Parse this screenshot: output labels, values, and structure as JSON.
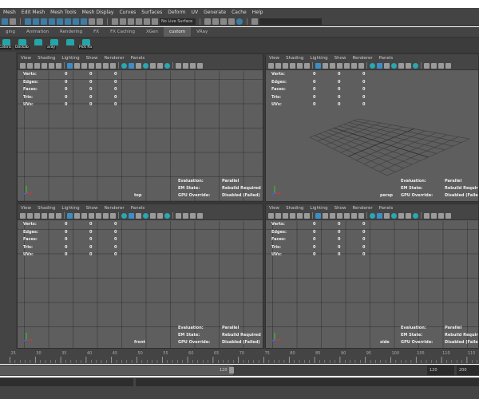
{
  "menubar": [
    "Mesh",
    "Edit Mesh",
    "Mesh Tools",
    "Mesh Display",
    "Curves",
    "Surfaces",
    "Deform",
    "UV",
    "Generate",
    "Cache",
    "Help"
  ],
  "toolbar": {
    "live_surface": "No Live Surface"
  },
  "shelf_tabs": [
    {
      "label": "ging"
    },
    {
      "label": "Animation"
    },
    {
      "label": "Rendering"
    },
    {
      "label": "FX"
    },
    {
      "label": "FX Caching"
    },
    {
      "label": "XGen"
    },
    {
      "label": "custom",
      "active": true
    },
    {
      "label": "VRay"
    }
  ],
  "shelf_buttons": [
    "Coloric",
    "Dockab",
    "",
    "aray",
    "",
    "Pick Ra"
  ],
  "viewport_menu": [
    "View",
    "Shading",
    "Lighting",
    "Show",
    "Renderer",
    "Panels"
  ],
  "viewport_icons": [
    "camera",
    "camera-attr",
    "bookmark",
    "image-plane",
    "grid-snap",
    "pencil",
    "|",
    "grid-a",
    "film-gate",
    "resolution-gate",
    "gate-mask",
    "field-chart",
    "safe-action",
    "safe-title",
    "|",
    "wireframe-c",
    "smooth-shade-a",
    "lighting",
    "textured-c",
    "shadows",
    "lights",
    "ambient-occlusion-c",
    "|",
    "isolate",
    "xray",
    "xray-joints",
    "backface"
  ],
  "hud": {
    "rows": [
      {
        "label": "Verts:",
        "values": [
          "0",
          "0",
          "0"
        ]
      },
      {
        "label": "Edges:",
        "values": [
          "0",
          "0",
          "0"
        ]
      },
      {
        "label": "Faces:",
        "values": [
          "0",
          "0",
          "0"
        ]
      },
      {
        "label": "Tris:",
        "values": [
          "0",
          "0",
          "0"
        ]
      },
      {
        "label": "UVs:",
        "values": [
          "0",
          "0",
          "0"
        ]
      }
    ],
    "eval": [
      {
        "label": "Evaluation:",
        "value": "Parallel"
      },
      {
        "label": "EM State:",
        "value": "Rebuild Required"
      },
      {
        "label": "GPU Override:",
        "value": "Disabled (Failed)"
      }
    ]
  },
  "viewports": [
    {
      "camera": "top"
    },
    {
      "camera": "persp"
    },
    {
      "camera": "front"
    },
    {
      "camera": "side"
    }
  ],
  "timeline": {
    "ticks": [
      "25",
      "30",
      "35",
      "40",
      "45",
      "50",
      "55",
      "60",
      "65",
      "70",
      "75",
      "80",
      "85",
      "90",
      "95",
      "100",
      "105",
      "110",
      "115"
    ]
  },
  "range": {
    "slider_end": "120",
    "end_time": "120",
    "anim_end": "200"
  },
  "colors": {
    "accent": "#3b8fc6",
    "shelf": "#25a5a8"
  }
}
